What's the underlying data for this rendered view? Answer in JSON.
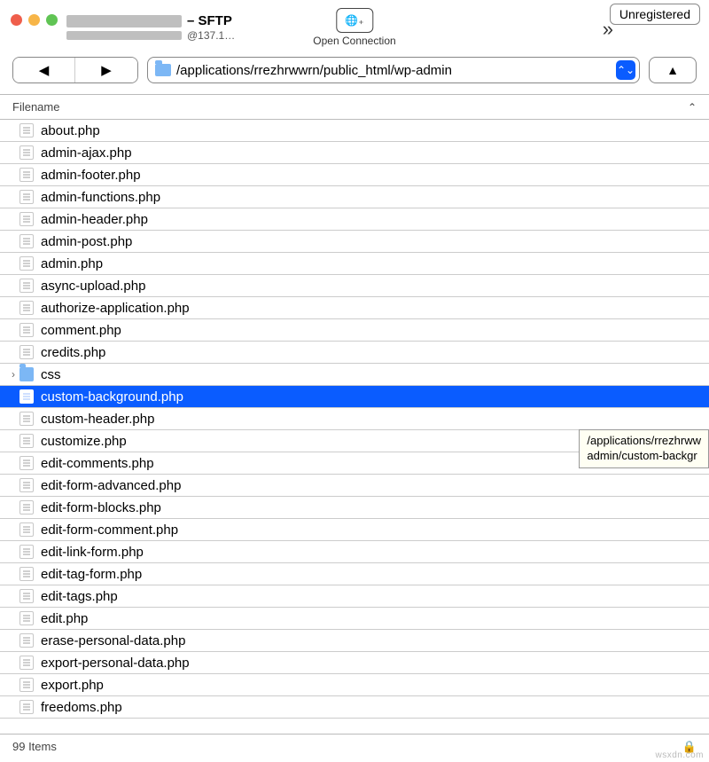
{
  "window": {
    "title_suffix": "– SFTP",
    "subtitle_prefix": "@137.1…",
    "open_connection_label": "Open Connection",
    "unregistered_label": "Unregistered",
    "overflow_glyph": "»"
  },
  "toolbar": {
    "back_glyph": "◀",
    "fwd_glyph": "▶",
    "path": "/applications/rrezhrwwrn/public_html/wp-admin",
    "up_glyph": "▲"
  },
  "column_header": "Filename",
  "files": [
    {
      "name": "about.php",
      "type": "file"
    },
    {
      "name": "admin-ajax.php",
      "type": "file"
    },
    {
      "name": "admin-footer.php",
      "type": "file"
    },
    {
      "name": "admin-functions.php",
      "type": "file"
    },
    {
      "name": "admin-header.php",
      "type": "file"
    },
    {
      "name": "admin-post.php",
      "type": "file"
    },
    {
      "name": "admin.php",
      "type": "file"
    },
    {
      "name": "async-upload.php",
      "type": "file"
    },
    {
      "name": "authorize-application.php",
      "type": "file"
    },
    {
      "name": "comment.php",
      "type": "file"
    },
    {
      "name": "credits.php",
      "type": "file"
    },
    {
      "name": "css",
      "type": "folder"
    },
    {
      "name": "custom-background.php",
      "type": "file",
      "selected": true
    },
    {
      "name": "custom-header.php",
      "type": "file"
    },
    {
      "name": "customize.php",
      "type": "file"
    },
    {
      "name": "edit-comments.php",
      "type": "file"
    },
    {
      "name": "edit-form-advanced.php",
      "type": "file"
    },
    {
      "name": "edit-form-blocks.php",
      "type": "file"
    },
    {
      "name": "edit-form-comment.php",
      "type": "file"
    },
    {
      "name": "edit-link-form.php",
      "type": "file"
    },
    {
      "name": "edit-tag-form.php",
      "type": "file"
    },
    {
      "name": "edit-tags.php",
      "type": "file"
    },
    {
      "name": "edit.php",
      "type": "file"
    },
    {
      "name": "erase-personal-data.php",
      "type": "file"
    },
    {
      "name": "export-personal-data.php",
      "type": "file"
    },
    {
      "name": "export.php",
      "type": "file"
    },
    {
      "name": "freedoms.php",
      "type": "file"
    }
  ],
  "tooltip": {
    "line1": "/applications/rrezhrww",
    "line2": "admin/custom-backgr"
  },
  "status": {
    "count_text": "99 Items"
  },
  "watermark": "wsxdn.com"
}
